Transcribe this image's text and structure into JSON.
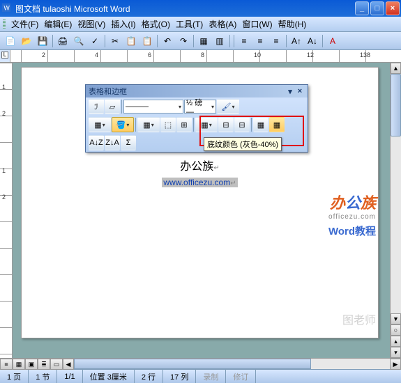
{
  "window": {
    "title": "图文档 tulaoshi Microsoft Word"
  },
  "menu": {
    "file": "文件(F)",
    "edit": "编辑(E)",
    "view": "视图(V)",
    "insert": "插入(I)",
    "format": "格式(O)",
    "tools": "工具(T)",
    "table": "表格(A)",
    "window": "窗口(W)",
    "help": "帮助(H)"
  },
  "ruler_h": {
    "labels": [
      "2",
      "4",
      "6",
      "8",
      "10",
      "12",
      "138"
    ]
  },
  "ruler_v": {
    "labels": [
      "1",
      "2",
      "1",
      "2",
      "1"
    ]
  },
  "float_toolbar": {
    "title": "表格和边框",
    "line_style": "———",
    "line_weight": "½ 磅 —"
  },
  "tooltip": {
    "text": "底纹颜色 (灰色-40%)"
  },
  "document": {
    "line1": "办公族",
    "line2": "www.officezu.com"
  },
  "watermark": {
    "brand_cn": "办公族",
    "brand_en": "officezu.com",
    "subtitle": "Word教程",
    "corner": "图老师"
  },
  "status": {
    "page": "1 页",
    "section": "1 节",
    "pages": "1/1",
    "position": "位置 3厘米",
    "line": "2 行",
    "col": "17 列",
    "rec": "录制",
    "rev": "修订"
  },
  "icons": {
    "new": "📄",
    "open": "📂",
    "save": "💾",
    "print": "🖨",
    "preview": "🔍",
    "spell": "✓",
    "cut": "✂",
    "copy": "📋",
    "paste": "📋",
    "undo": "↶",
    "redo": "↷",
    "table_insert": "▦",
    "columns": "▥",
    "align_left": "≡",
    "align_center": "≡",
    "align_right": "≡",
    "font_inc": "A↑",
    "font_dec": "A↓",
    "font": "A",
    "pencil": "ℐ",
    "eraser": "▱",
    "paint": "🖌",
    "shade": "🪣",
    "border_out": "▦",
    "merge": "⬚",
    "split": "⊞",
    "align_tl": "▦",
    "distribute": "⊟",
    "table_af": "▦",
    "hide_grid": "▦",
    "sort_az": "A↓Z",
    "sort_za": "Z↓A",
    "sum": "Σ"
  }
}
